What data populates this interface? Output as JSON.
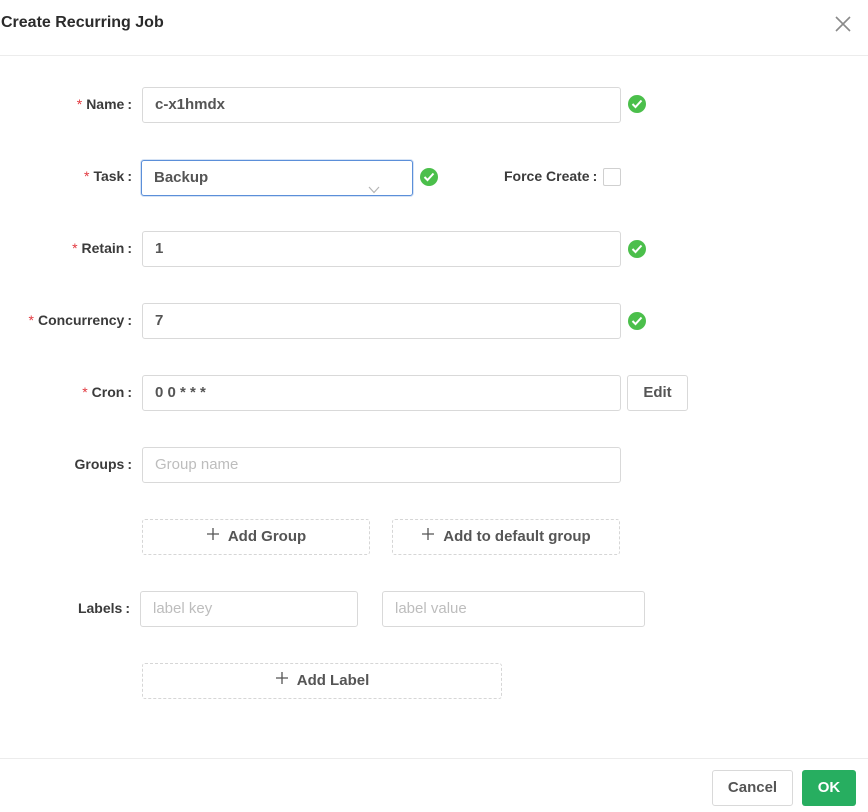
{
  "dialog": {
    "title": "Create Recurring Job"
  },
  "form": {
    "name": {
      "label": "Name",
      "value": "c-x1hmdx"
    },
    "task": {
      "label": "Task",
      "value": "Backup"
    },
    "force_create": {
      "label": "Force Create",
      "checked": false
    },
    "retain": {
      "label": "Retain",
      "value": "1"
    },
    "concurrency": {
      "label": "Concurrency",
      "value": "7"
    },
    "cron": {
      "label": "Cron",
      "value": "0 0 * * *",
      "edit_label": "Edit"
    },
    "groups": {
      "label": "Groups",
      "placeholder": "Group name",
      "add_group_label": "Add Group",
      "add_default_label": "Add to default group"
    },
    "labels": {
      "label": "Labels",
      "key_placeholder": "label key",
      "value_placeholder": "label value",
      "add_label": "Add Label"
    },
    "colon": ":",
    "required_mark": "*"
  },
  "footer": {
    "cancel_label": "Cancel",
    "ok_label": "OK"
  },
  "colors": {
    "ok_button": "#27ae60",
    "valid_icon": "#4bbf4b",
    "required": "#e2383f",
    "focus_border": "#5b8fd9"
  },
  "icons": {
    "close": "close-icon",
    "valid": "check-circle-icon",
    "dropdown": "chevron-down-icon",
    "add": "plus-icon"
  }
}
